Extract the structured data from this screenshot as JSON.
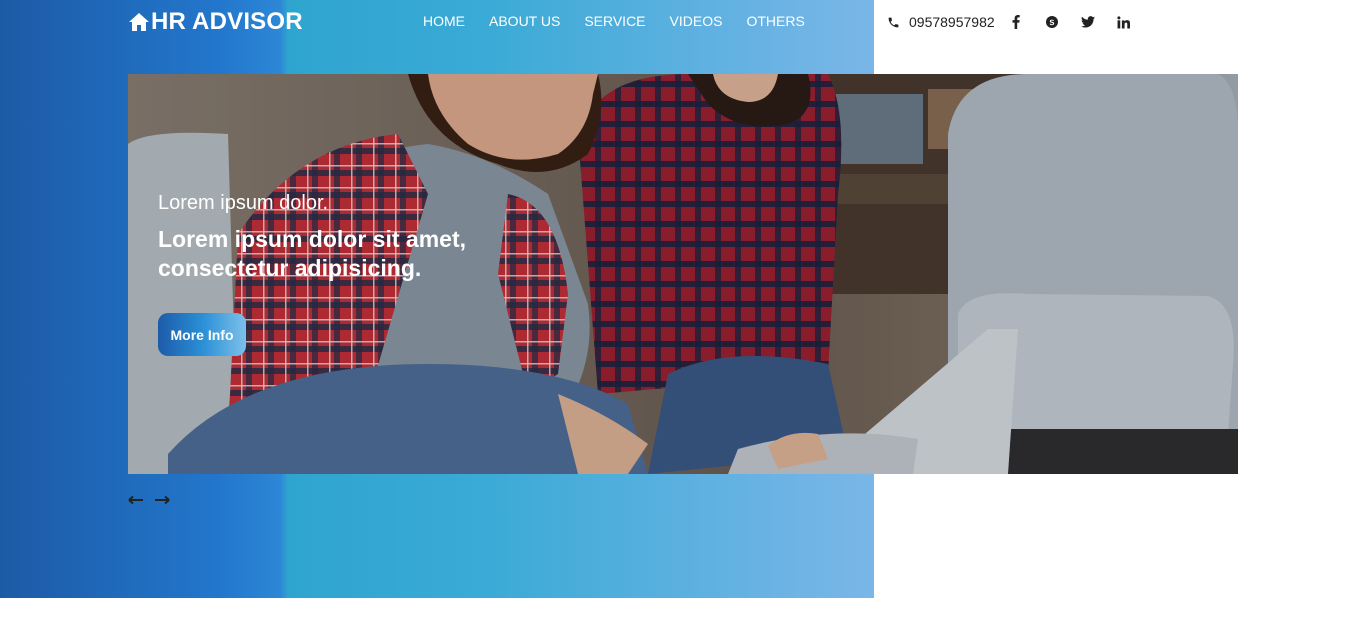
{
  "brand": {
    "name": "HR ADVISOR",
    "icon": "home-icon"
  },
  "nav": {
    "items": [
      {
        "label": "HOME"
      },
      {
        "label": "ABOUT US"
      },
      {
        "label": "SERVICE"
      },
      {
        "label": "VIDEOS"
      },
      {
        "label": "OTHERS"
      }
    ]
  },
  "contact": {
    "phone": "09578957982",
    "phone_icon": "phone-icon",
    "social": [
      "facebook-icon",
      "skype-icon",
      "twitter-icon",
      "linkedin-icon"
    ]
  },
  "hero": {
    "subtitle": "Lorem ipsum dolor.",
    "title": "Lorem ipsum dolor sit amet, consectetur adipisicing.",
    "button_label": "More Info"
  },
  "slider": {
    "prev_icon": "arrow-left-icon",
    "next_icon": "arrow-right-icon"
  },
  "colors": {
    "gradient_start": "#1d5aa6",
    "gradient_mid": "#2ea5cf",
    "gradient_end": "#7ab6e8",
    "text_dark": "#222222",
    "white": "#ffffff"
  }
}
